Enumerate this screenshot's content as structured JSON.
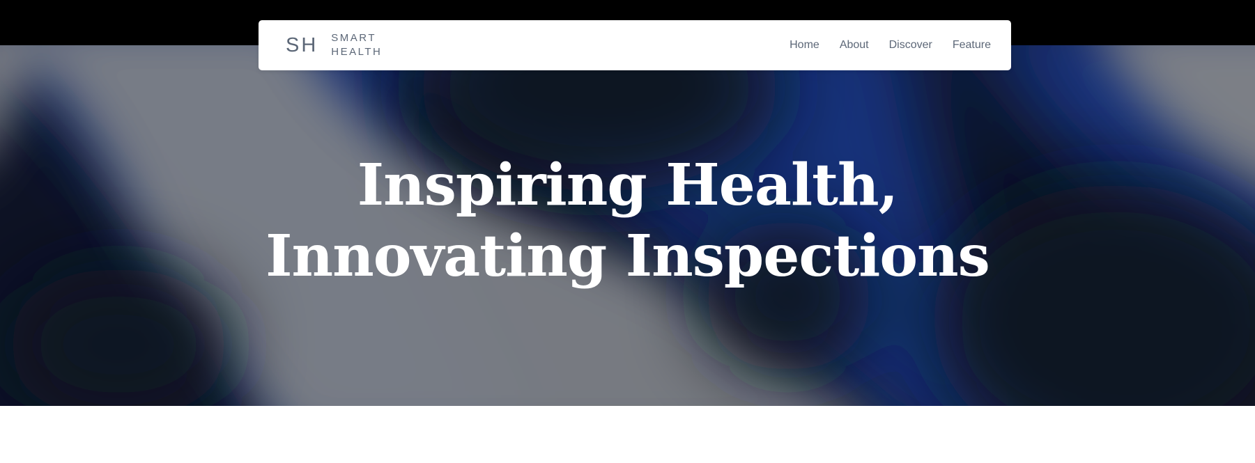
{
  "brand": {
    "mark": "SH",
    "line1": "SMART",
    "line2": "HEALTH"
  },
  "nav": {
    "items": [
      {
        "label": "Home"
      },
      {
        "label": "About"
      },
      {
        "label": "Discover"
      },
      {
        "label": "Feature"
      }
    ]
  },
  "hero": {
    "title_line1": "Inspiring Health,",
    "title_line2": "Innovating Inspections"
  },
  "colors": {
    "top_strip": "#000000",
    "nav_text": "#5c6777",
    "hero_text": "#ffffff",
    "hero_dark": "#0d1224",
    "hero_blue": "#12307a",
    "hero_gray": "#7c7f86"
  }
}
